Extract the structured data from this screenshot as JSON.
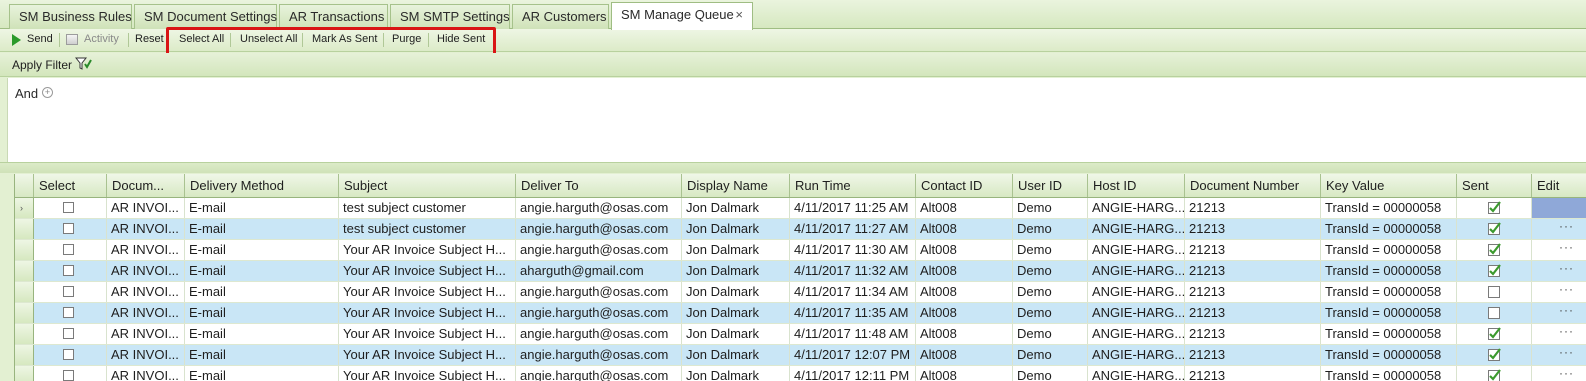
{
  "tabs": [
    {
      "label": "SM Business Rules",
      "active": false
    },
    {
      "label": "SM Document Settings",
      "active": false
    },
    {
      "label": "AR Transactions",
      "active": false
    },
    {
      "label": "SM SMTP Settings",
      "active": false
    },
    {
      "label": "AR Customers",
      "active": false
    },
    {
      "label": "SM Manage Queue",
      "active": true,
      "close": "×"
    }
  ],
  "toolbar": {
    "send": "Send",
    "activity": "Activity",
    "reset": "Reset",
    "select_all": "Select All",
    "unselect_all": "Unselect All",
    "mark_as_sent": "Mark As Sent",
    "purge": "Purge",
    "hide_sent": "Hide Sent"
  },
  "filter": {
    "apply_label": "Apply Filter",
    "and_label": "And",
    "plus_glyph": "+"
  },
  "grid": {
    "columns": [
      "Select",
      "Docum...",
      "Delivery Method",
      "Subject",
      "Deliver To",
      "Display Name",
      "Run Time",
      "Contact ID",
      "User ID",
      "Host ID",
      "Document Number",
      "Key Value",
      "Sent",
      "Edit"
    ],
    "current_row_glyph": "›",
    "edit_glyph": "···",
    "rows": [
      {
        "doc": "AR INVOI...",
        "method": "E-mail",
        "subject": "test subject customer",
        "deliver_to": "angie.harguth@osas.com",
        "display_name": "Jon Dalmark",
        "run_time": "4/11/2017 11:25 AM",
        "contact_id": "Alt008",
        "user_id": "Demo",
        "host_id": "ANGIE-HARG...",
        "doc_number": "21213",
        "key_value": "TransId = 00000058",
        "sent": true
      },
      {
        "doc": "AR INVOI...",
        "method": "E-mail",
        "subject": "test subject customer",
        "deliver_to": "angie.harguth@osas.com",
        "display_name": "Jon Dalmark",
        "run_time": "4/11/2017 11:27 AM",
        "contact_id": "Alt008",
        "user_id": "Demo",
        "host_id": "ANGIE-HARG...",
        "doc_number": "21213",
        "key_value": "TransId = 00000058",
        "sent": true
      },
      {
        "doc": "AR INVOI...",
        "method": "E-mail",
        "subject": "Your AR Invoice Subject H...",
        "deliver_to": "angie.harguth@osas.com",
        "display_name": "Jon Dalmark",
        "run_time": "4/11/2017 11:30 AM",
        "contact_id": "Alt008",
        "user_id": "Demo",
        "host_id": "ANGIE-HARG...",
        "doc_number": "21213",
        "key_value": "TransId = 00000058",
        "sent": true
      },
      {
        "doc": "AR INVOI...",
        "method": "E-mail",
        "subject": "Your AR Invoice Subject H...",
        "deliver_to": "aharguth@gmail.com",
        "display_name": "Jon Dalmark",
        "run_time": "4/11/2017 11:32 AM",
        "contact_id": "Alt008",
        "user_id": "Demo",
        "host_id": "ANGIE-HARG...",
        "doc_number": "21213",
        "key_value": "TransId = 00000058",
        "sent": true
      },
      {
        "doc": "AR INVOI...",
        "method": "E-mail",
        "subject": "Your AR Invoice Subject H...",
        "deliver_to": "angie.harguth@osas.com",
        "display_name": "Jon Dalmark",
        "run_time": "4/11/2017 11:34 AM",
        "contact_id": "Alt008",
        "user_id": "Demo",
        "host_id": "ANGIE-HARG...",
        "doc_number": "21213",
        "key_value": "TransId = 00000058",
        "sent": false
      },
      {
        "doc": "AR INVOI...",
        "method": "E-mail",
        "subject": "Your AR Invoice Subject H...",
        "deliver_to": "angie.harguth@osas.com",
        "display_name": "Jon Dalmark",
        "run_time": "4/11/2017 11:35 AM",
        "contact_id": "Alt008",
        "user_id": "Demo",
        "host_id": "ANGIE-HARG...",
        "doc_number": "21213",
        "key_value": "TransId = 00000058",
        "sent": false
      },
      {
        "doc": "AR INVOI...",
        "method": "E-mail",
        "subject": "Your AR Invoice Subject H...",
        "deliver_to": "angie.harguth@osas.com",
        "display_name": "Jon Dalmark",
        "run_time": "4/11/2017 11:48 AM",
        "contact_id": "Alt008",
        "user_id": "Demo",
        "host_id": "ANGIE-HARG...",
        "doc_number": "21213",
        "key_value": "TransId = 00000058",
        "sent": true
      },
      {
        "doc": "AR INVOI...",
        "method": "E-mail",
        "subject": "Your AR Invoice Subject H...",
        "deliver_to": "angie.harguth@osas.com",
        "display_name": "Jon Dalmark",
        "run_time": "4/11/2017 12:07 PM",
        "contact_id": "Alt008",
        "user_id": "Demo",
        "host_id": "ANGIE-HARG...",
        "doc_number": "21213",
        "key_value": "TransId = 00000058",
        "sent": true
      },
      {
        "doc": "AR INVOI...",
        "method": "E-mail",
        "subject": "Your AR Invoice Subject H...",
        "deliver_to": "angie.harguth@osas.com",
        "display_name": "Jon Dalmark",
        "run_time": "4/11/2017 12:11 PM",
        "contact_id": "Alt008",
        "user_id": "Demo",
        "host_id": "ANGIE-HARG...",
        "doc_number": "21213",
        "key_value": "TransId = 00000058",
        "sent": true
      }
    ]
  },
  "colors": {
    "accent_green": "#2a9a2a",
    "highlight_red": "#d91515",
    "alt_row_blue": "#c9e6f6",
    "check_green": "#3c9a2e"
  }
}
